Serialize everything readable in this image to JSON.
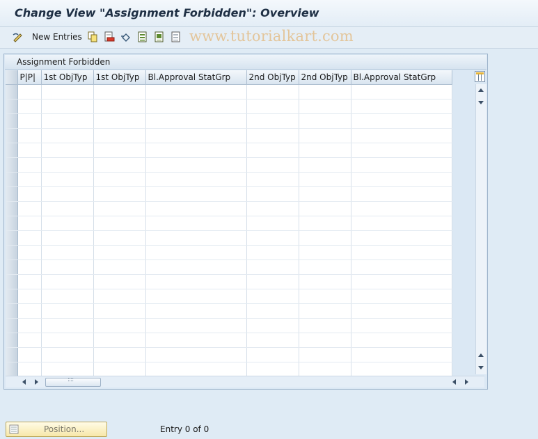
{
  "window": {
    "title": "Change View \"Assignment Forbidden\": Overview"
  },
  "toolbar": {
    "new_entries_label": "New Entries",
    "icons": [
      "edit-pencil-icon",
      "copy-icon",
      "delete-icon",
      "undo-icon",
      "select-all-icon",
      "select-block-icon",
      "deselect-all-icon"
    ]
  },
  "watermark": "www.tutorialkart.com",
  "panel": {
    "title": "Assignment Forbidden",
    "columns": [
      "P|P|",
      "1st ObjTyp",
      "1st ObjTyp",
      "Bl.Approval StatGrp",
      "2nd ObjTyp",
      "2nd ObjTyp",
      "Bl.Approval StatGrp"
    ],
    "row_count": 20,
    "rows": []
  },
  "footer": {
    "position_label": "Position...",
    "entry_text": "Entry 0 of 0"
  },
  "colors": {
    "accent": "#1e2f44",
    "button": "#f7e8a9",
    "watermark": "#e3c59a"
  }
}
